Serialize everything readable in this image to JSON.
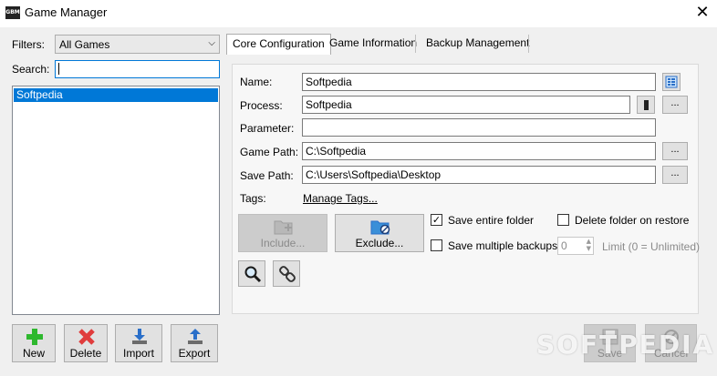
{
  "window": {
    "title": "Game Manager",
    "icon_text": "GBM",
    "close_glyph": "✕"
  },
  "filters": {
    "label": "Filters:",
    "selected": "All Games",
    "arrow": "⌵"
  },
  "search": {
    "label": "Search:",
    "value": ""
  },
  "game_list": {
    "items": [
      "Softpedia"
    ],
    "selected_index": 0
  },
  "tabs": [
    {
      "label": "Core Configuration",
      "active": true
    },
    {
      "label": "Game Information",
      "active": false
    },
    {
      "label": "Backup Management",
      "active": false
    }
  ],
  "form": {
    "name": {
      "label": "Name:",
      "value": "Softpedia"
    },
    "process": {
      "label": "Process:",
      "value": "Softpedia"
    },
    "parameter": {
      "label": "Parameter:",
      "value": ""
    },
    "game_path": {
      "label": "Game Path:",
      "value": "C:\\Softpedia"
    },
    "save_path": {
      "label": "Save Path:",
      "value": "C:\\Users\\Softpedia\\Desktop"
    },
    "tags": {
      "label": "Tags:",
      "link": "Manage Tags..."
    },
    "browse_label": "..."
  },
  "buttons": {
    "include": "Include...",
    "exclude": "Exclude..."
  },
  "options": {
    "save_entire_folder": {
      "label": "Save entire folder",
      "checked": true
    },
    "delete_folder_on_restore": {
      "label": "Delete folder on restore",
      "checked": false
    },
    "save_multiple_backups": {
      "label": "Save multiple backups",
      "checked": false
    },
    "limit": {
      "value": "0",
      "label": "Limit (0 = Unlimited)"
    }
  },
  "check_glyph": "✓",
  "bottom_left": {
    "new": "New",
    "delete": "Delete",
    "import": "Import",
    "export": "Export"
  },
  "bottom_right": {
    "save": "Save",
    "cancel": "Cancel"
  },
  "watermark": "SOFTPEDIA",
  "colors": {
    "selection": "#0078d7",
    "new_icon": "#2eb82e",
    "delete_icon": "#e03c3c",
    "import_icon": "#2a6fc9",
    "folder_icon": "#3a8fd8"
  }
}
